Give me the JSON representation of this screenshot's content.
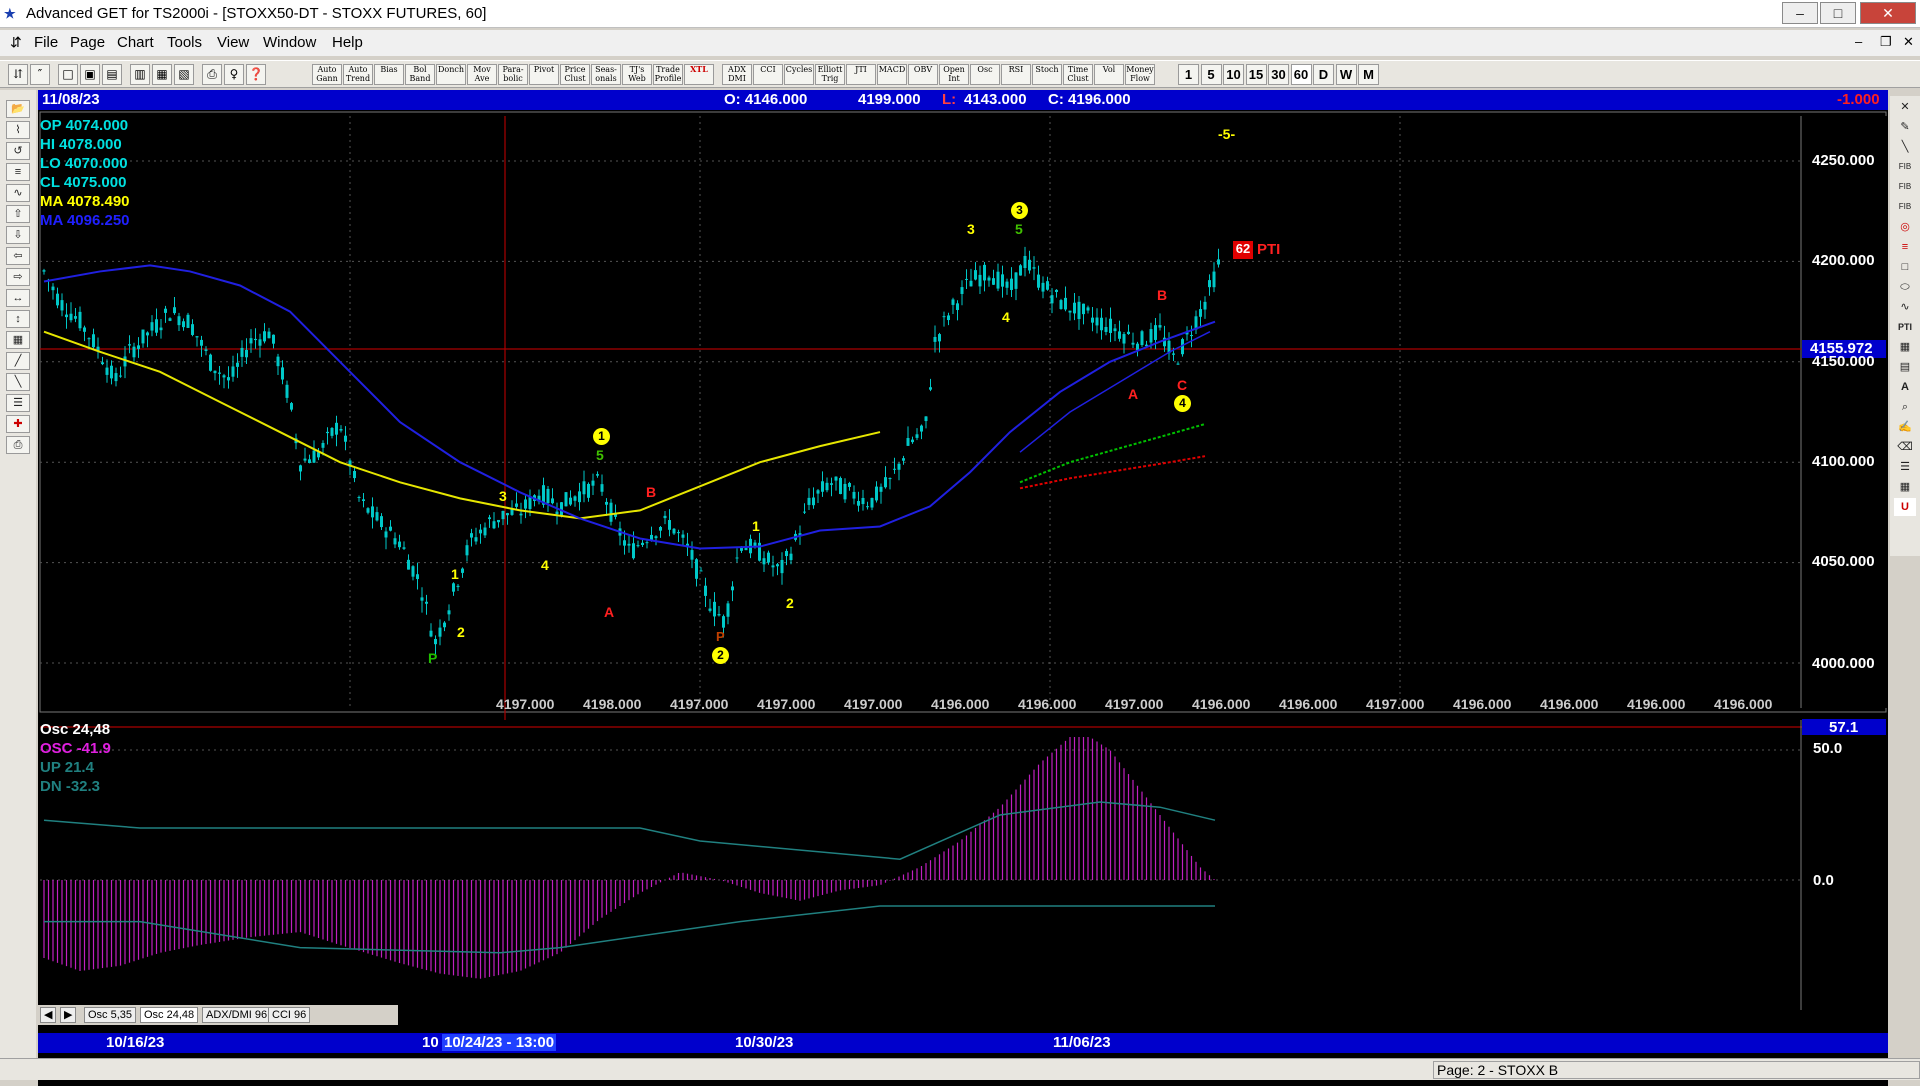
{
  "window": {
    "title": "Advanced GET for TS2000i - [STOXX50-DT - STOXX FUTURES, 60]",
    "min_label": "–",
    "max_label": "□",
    "close_label": "✕"
  },
  "menu": [
    "File",
    "Page",
    "Chart",
    "Tools",
    "View",
    "Window",
    "Help"
  ],
  "toolbar": {
    "studies": [
      "Auto Gann",
      "Auto Trend",
      "Bias",
      "Bol Band",
      "Donch",
      "Mov Ave",
      "Para-bolic",
      "Pivot",
      "Price Clust",
      "Seas-onals",
      "TJ's Web",
      "Trade Profile",
      "XTL",
      "ADX DMI",
      "CCI",
      "Cycles",
      "Elliott Trig",
      "JTI",
      "MACD",
      "OBV",
      "Open Int",
      "Osc",
      "RSI",
      "Stoch",
      "Time Clust",
      "Vol",
      "Money Flow"
    ],
    "timeframes": [
      "1",
      "5",
      "10",
      "15",
      "30",
      "60",
      "D",
      "W",
      "M"
    ]
  },
  "header": {
    "date": "11/08/23",
    "open": "O: 4146.000",
    "high": "4199.000",
    "low_label": "L:",
    "low": "4143.000",
    "close": "C: 4196.000",
    "change": "-1.000"
  },
  "readout": [
    {
      "label": "OP  4074.000",
      "color": "#00e0e0"
    },
    {
      "label": "HI   4078.000",
      "color": "#00e0e0"
    },
    {
      "label": "LO  4070.000",
      "color": "#00e0e0"
    },
    {
      "label": "CL  4075.000",
      "color": "#00e0e0"
    },
    {
      "label": "MA  4078.490",
      "color": "#ffff00"
    },
    {
      "label": "MA  4096.250",
      "color": "#2020ff"
    }
  ],
  "price_axis": [
    "4250.000",
    "4200.000",
    "4150.000",
    "4100.000",
    "4050.000",
    "4000.000"
  ],
  "cursor_price": "4155.972",
  "bottom_values": [
    "4197.000",
    "4198.000",
    "4197.000",
    "4197.000",
    "4197.000",
    "4196.000",
    "4196.000",
    "4197.000",
    "4196.000",
    "4196.000",
    "4197.000",
    "4196.000",
    "4196.000",
    "4196.000",
    "4196.000"
  ],
  "wave_labels": {
    "top5": "-5-",
    "pti_num": "62",
    "pti": "PTI",
    "w1_circle": "1",
    "w5_a": "5",
    "w3_circle": "3",
    "w5_b": "5",
    "w3": "3",
    "w4": "4",
    "wB1": "B",
    "wA1": "A",
    "wP": "P",
    "w1": "1",
    "w2": "2",
    "w3b": "3",
    "w4b": "4",
    "wB2": "B",
    "wA2": "A",
    "wC": "C",
    "w4_circle": "4",
    "w2_circle": "2",
    "wP2": "P",
    "w1c": "1",
    "w2c": "2",
    "wB3": "B"
  },
  "oscillator": {
    "title": "Osc 24,48",
    "osc": "OSC -41.9",
    "up": "UP  21.4",
    "dn": "DN  -32.3",
    "axis_top": "57.1",
    "axis_50": "50.0",
    "axis_0": "0.0"
  },
  "tabs": [
    "Osc 5,35",
    "Osc 24,48",
    "ADX/DMI 96",
    "CCI 96"
  ],
  "time_axis": [
    "10/16/23",
    "10",
    "10/24/23 - 13:00",
    "10/30/23",
    "11/06/23"
  ],
  "status": {
    "page": "Page: 2 - STOXX B"
  }
}
